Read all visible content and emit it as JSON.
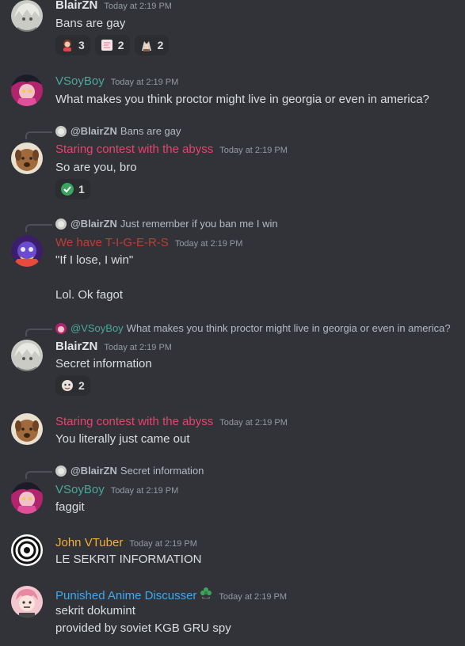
{
  "colors": {
    "background": "#313338",
    "text": "#dbdee1",
    "timestamp": "#949ba4",
    "blair": "#e3e5e8",
    "vsoyboy": "#4aa89b",
    "staring": "#e8436d",
    "tigers": "#c13d32",
    "john": "#f0b232",
    "punished": "#3ea8f0"
  },
  "messages": [
    {
      "author": "BlairZN",
      "time": "Today at 2:19 PM",
      "lines": [
        "Bans are gay"
      ],
      "reactions": [
        {
          "emoji": "anime-girl-emoji",
          "count": "3"
        },
        {
          "emoji": "pink-sticker-emoji",
          "count": "2"
        },
        {
          "emoji": "anime-character-emoji",
          "count": "2"
        }
      ]
    },
    {
      "author": "VSoyBoy",
      "time": "Today at 2:19 PM",
      "lines": [
        "What makes you think proctor might live in georgia or even in america?"
      ]
    },
    {
      "reply": {
        "author": "@BlairZN",
        "text": "Bans are gay"
      },
      "author": "Staring contest with the abyss",
      "time": "Today at 2:19 PM",
      "lines": [
        "So are you, bro"
      ],
      "reactions": [
        {
          "emoji": "check-mark-emoji",
          "count": "1"
        }
      ]
    },
    {
      "reply": {
        "author": "@BlairZN",
        "text": "Just remember if you ban me I win"
      },
      "author": "We have T-I-G-E-R-S",
      "time": "Today at 2:19 PM",
      "lines": [
        "\"If I lose, I win\"",
        "Lol. Ok fagot"
      ]
    },
    {
      "reply": {
        "author": "@VSoyBoy",
        "text": "What makes you think proctor might live in georgia or even in america?"
      },
      "author": "BlairZN",
      "time": "Today at 2:19 PM",
      "lines": [
        "Secret information"
      ],
      "reactions": [
        {
          "emoji": "face-emoji",
          "count": "2"
        }
      ]
    },
    {
      "author": "Staring contest with the abyss",
      "time": "Today at 2:19 PM",
      "lines": [
        "You literally just came out"
      ]
    },
    {
      "reply": {
        "author": "@BlairZN",
        "text": "Secret information"
      },
      "author": "VSoyBoy",
      "time": "Today at 2:19 PM",
      "lines": [
        "faggit"
      ]
    },
    {
      "author": "John VTuber",
      "time": "Today at 2:19 PM",
      "lines": [
        "LE SEKRIT INFORMATION"
      ]
    },
    {
      "author": "Punished Anime Discusser",
      "author_badge": "green-flower-badge-icon",
      "time": "Today at 2:19 PM",
      "lines": [
        "sekrit dokumint",
        "provided by soviet KGB GRU spy"
      ]
    }
  ]
}
